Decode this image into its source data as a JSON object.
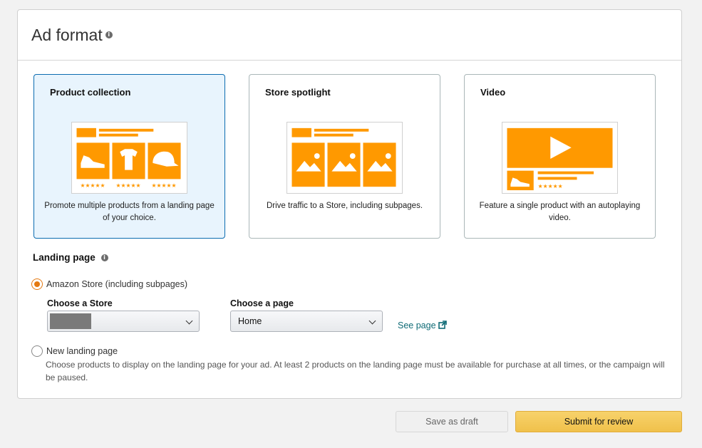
{
  "panel": {
    "title": "Ad format",
    "info_icon": "info-icon"
  },
  "cards": [
    {
      "title": "Product collection",
      "description": "Promote multiple products from a landing page of your choice.",
      "selected": true,
      "illustration": "product-collection-illustration"
    },
    {
      "title": "Store spotlight",
      "description": "Drive traffic to a Store, including subpages.",
      "selected": false,
      "illustration": "store-spotlight-illustration"
    },
    {
      "title": "Video",
      "description": "Feature a single product with an autoplaying video.",
      "selected": false,
      "illustration": "video-illustration"
    }
  ],
  "landing": {
    "label": "Landing page",
    "option_store": "Amazon Store (including subpages)",
    "choose_store_label": "Choose a Store",
    "choose_page_label": "Choose a page",
    "page_value": "Home",
    "see_page": "See page",
    "option_new": "New landing page",
    "new_desc": "Choose products to display on the landing page for your ad. At least 2 products on the landing page must be available for purchase at all times, or the campaign will be paused."
  },
  "buttons": {
    "save_draft": "Save as draft",
    "submit": "Submit for review"
  },
  "colors": {
    "accent": "#f90",
    "selected_bg": "#e8f4fd",
    "selected_border": "#0b6cb0",
    "link": "#0f6b76",
    "submit": "#f0c14b"
  }
}
